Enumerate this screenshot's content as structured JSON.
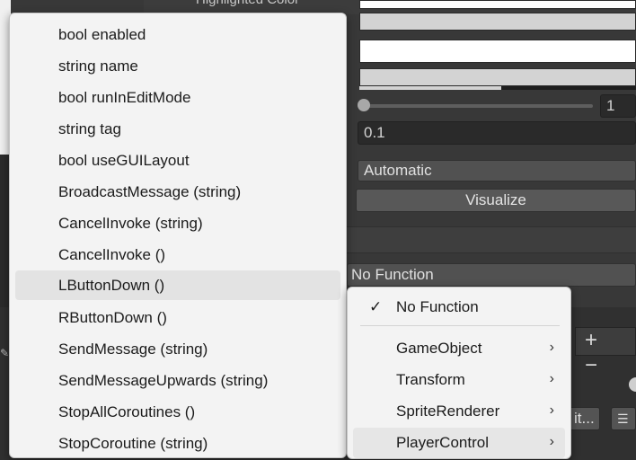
{
  "inspector": {
    "highlighted_color_label": "Highlighted Color",
    "slider_value": "1",
    "numeric_field": "0.1",
    "dropdown_value": "Automatic",
    "visualize_button": "Visualize",
    "event_function": "No Function",
    "add_symbol": "+",
    "remove_symbol": "−",
    "bottom_button_label": "it...",
    "list_button_icon": "list-icon"
  },
  "member_menu": {
    "items": [
      {
        "label": "bool enabled"
      },
      {
        "label": "string name"
      },
      {
        "label": "bool runInEditMode"
      },
      {
        "label": "string tag"
      },
      {
        "label": "bool useGUILayout"
      },
      {
        "label": "BroadcastMessage (string)"
      },
      {
        "label": "CancelInvoke (string)"
      },
      {
        "label": "CancelInvoke ()"
      },
      {
        "label": "LButtonDown ()",
        "hovered": true
      },
      {
        "label": "RButtonDown ()"
      },
      {
        "label": "SendMessage (string)"
      },
      {
        "label": "SendMessageUpwards (string)"
      },
      {
        "label": "StopAllCoroutines ()"
      },
      {
        "label": "StopCoroutine (string)"
      }
    ]
  },
  "component_menu": {
    "checked_item": "No Function",
    "check_mark": "✓",
    "items": [
      {
        "label": "GameObject",
        "chevron": "›"
      },
      {
        "label": "Transform",
        "chevron": "›"
      },
      {
        "label": "SpriteRenderer",
        "chevron": "›"
      },
      {
        "label": "PlayerControl",
        "chevron": "›",
        "hovered": true
      }
    ]
  }
}
